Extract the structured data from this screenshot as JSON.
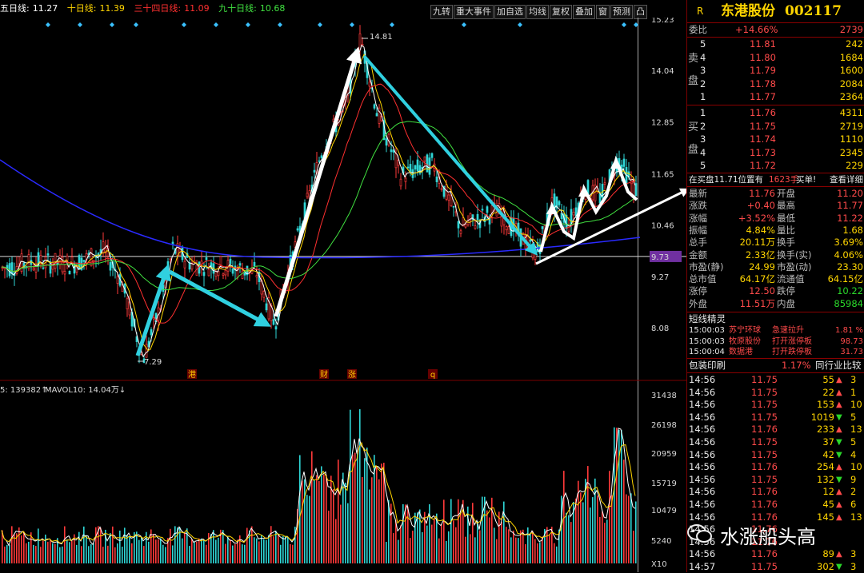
{
  "ma_strip": {
    "ma5_label": "五日线:",
    "ma5_value": "11.27",
    "ma10_label": "十日线:",
    "ma10_value": "11.39",
    "ma34_label": "三十四日线:",
    "ma34_value": "11.09",
    "ma90_label": "九十日线:",
    "ma90_value": "10.68",
    "colors": {
      "ma5": "#ffffff",
      "ma10": "#ffd500",
      "ma34": "#ff3030",
      "ma90": "#40e040"
    }
  },
  "toolbar": [
    "九转",
    "重大事件",
    "加自选",
    "均线",
    "复权",
    "叠加",
    "窗",
    "预测",
    "凸"
  ],
  "price_axis": {
    "labels": [
      "15.23",
      "14.04",
      "12.85",
      "11.65",
      "10.46",
      "9.73",
      "9.27",
      "8.08"
    ],
    "current_price_marker": "9.73"
  },
  "annotations": {
    "high": "14.81",
    "low": "7.29",
    "events": [
      "港",
      "财",
      "涨",
      "q"
    ]
  },
  "volume_header": {
    "left": "5: 139382↑",
    "mavol": "MAVOL10: 14.04万↓"
  },
  "volume_axis": {
    "labels": [
      "31438",
      "26198",
      "20959",
      "15719",
      "10479",
      "5240",
      "X10"
    ]
  },
  "quote": {
    "header_r": "R",
    "name": "东港股份",
    "code": "002117",
    "webi_label": "委比",
    "webi_value": "+14.66%",
    "webi_diff": "2739",
    "sell_label": [
      "卖",
      "盘"
    ],
    "sell": [
      {
        "level": "5",
        "price": "11.81",
        "vol": "242"
      },
      {
        "level": "4",
        "price": "11.80",
        "vol": "1684"
      },
      {
        "level": "3",
        "price": "11.79",
        "vol": "1600"
      },
      {
        "level": "2",
        "price": "11.78",
        "vol": "2084"
      },
      {
        "level": "1",
        "price": "11.77",
        "vol": "2364"
      }
    ],
    "buy_label": [
      "买",
      "盘"
    ],
    "buy": [
      {
        "level": "1",
        "price": "11.76",
        "vol": "4311"
      },
      {
        "level": "2",
        "price": "11.75",
        "vol": "2719"
      },
      {
        "level": "3",
        "price": "11.74",
        "vol": "1110"
      },
      {
        "level": "4",
        "price": "11.73",
        "vol": "2345"
      },
      {
        "level": "5",
        "price": "11.72",
        "vol": "229"
      }
    ],
    "notice": "在买盘11.71位置有",
    "notice_vol": "1623手",
    "notice_tail": "买单!",
    "notice_link": "查看详细"
  },
  "stats": [
    {
      "k1": "最新",
      "v1": "11.76",
      "k2": "开盘",
      "v2": "11.20"
    },
    {
      "k1": "涨跌",
      "v1": "+0.40",
      "k2": "最高",
      "v2": "11.77"
    },
    {
      "k1": "涨幅",
      "v1": "+3.52%",
      "k2": "最低",
      "v2": "11.22"
    },
    {
      "k1": "振幅",
      "v1": "4.84%",
      "k2": "量比",
      "v2": "1.68"
    },
    {
      "k1": "总手",
      "v1": "20.11万",
      "k2": "换手",
      "v2": "3.69%"
    },
    {
      "k1": "金额",
      "v1": "2.33亿",
      "k2": "换手(实)",
      "v2": "4.06%"
    },
    {
      "k1": "市盈(静)",
      "v1": "24.99",
      "k2": "市盈(动)",
      "v2": "23.30"
    },
    {
      "k1": "总市值",
      "v1": "64.17亿",
      "k2": "流通值",
      "v2": "64.15亿"
    },
    {
      "k1": "涨停",
      "v1": "12.50",
      "k2": "跌停",
      "v2": "10.22"
    },
    {
      "k1": "外盘",
      "v1": "11.51万",
      "k2": "内盘",
      "v2": "85984"
    }
  ],
  "sprite": {
    "title": "短线精灵",
    "items": [
      {
        "time": "15:00:03",
        "stock": "苏宁环球",
        "event": "急速拉升",
        "value": "1.81 %"
      },
      {
        "time": "15:00:03",
        "stock": "牧原股份",
        "event": "打开涨停板",
        "value": "98.73"
      },
      {
        "time": "15:00:04",
        "stock": "数据港",
        "event": "打开跌停板",
        "value": "31.73"
      }
    ]
  },
  "industry": {
    "name": "包装印刷",
    "pct": "1.17%",
    "compare": "同行业比较"
  },
  "ticks": [
    {
      "time": "14:56",
      "price": "11.75",
      "vol": "55",
      "dir": "up",
      "extra": "3"
    },
    {
      "time": "14:56",
      "price": "11.75",
      "vol": "22",
      "dir": "up",
      "extra": "1"
    },
    {
      "time": "14:56",
      "price": "11.75",
      "vol": "153",
      "dir": "up",
      "extra": "10"
    },
    {
      "time": "14:56",
      "price": "11.75",
      "vol": "1019",
      "dir": "down",
      "extra": "5"
    },
    {
      "time": "14:56",
      "price": "11.76",
      "vol": "233",
      "dir": "up",
      "extra": "13"
    },
    {
      "time": "14:56",
      "price": "11.75",
      "vol": "37",
      "dir": "down",
      "extra": "5"
    },
    {
      "time": "14:56",
      "price": "11.75",
      "vol": "42",
      "dir": "down",
      "extra": "4"
    },
    {
      "time": "14:56",
      "price": "11.76",
      "vol": "254",
      "dir": "up",
      "extra": "10"
    },
    {
      "time": "14:56",
      "price": "11.75",
      "vol": "132",
      "dir": "down",
      "extra": "9"
    },
    {
      "time": "14:56",
      "price": "11.76",
      "vol": "12",
      "dir": "up",
      "extra": "2"
    },
    {
      "time": "14:56",
      "price": "11.76",
      "vol": "45",
      "dir": "up",
      "extra": "6"
    },
    {
      "time": "14:56",
      "price": "11.76",
      "vol": "145",
      "dir": "up",
      "extra": "13"
    },
    {
      "time": "14:56",
      "price": "11.76",
      "vol": "",
      "dir": "down",
      "extra": ""
    },
    {
      "time": "14:56",
      "price": "11.76",
      "vol": "",
      "dir": "down",
      "extra": ""
    },
    {
      "time": "14:56",
      "price": "11.76",
      "vol": "89",
      "dir": "up",
      "extra": "3"
    },
    {
      "time": "14:57",
      "price": "11.75",
      "vol": "302",
      "dir": "down",
      "extra": "3"
    }
  ],
  "watermark": "水涨船头高"
}
